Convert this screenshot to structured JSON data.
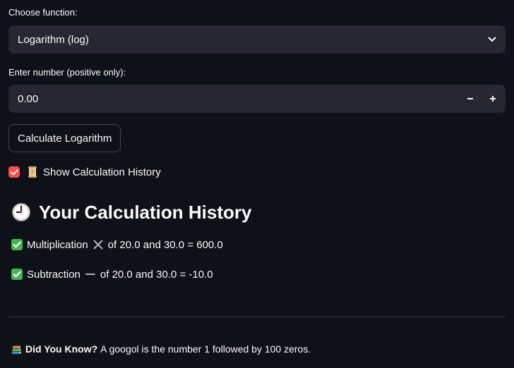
{
  "function_select": {
    "label": "Choose function:",
    "value": "Logarithm (log)"
  },
  "number_input": {
    "label": "Enter number (positive only):",
    "value": "0.00",
    "minus": "−",
    "plus": "+"
  },
  "calculate_button": {
    "label": "Calculate Logarithm"
  },
  "history_toggle": {
    "checked": true,
    "label": "Show Calculation History",
    "icon": "scroll-icon"
  },
  "history": {
    "title": "Your Calculation History",
    "title_icon": "clock-icon",
    "items": [
      {
        "icon": "check-mark-icon",
        "operation": "Multiplication",
        "operator_icon": "multiply-icon",
        "detail": "of 20.0 and 30.0 = 600.0"
      },
      {
        "icon": "check-mark-icon",
        "operation": "Subtraction",
        "operator_icon": "minus-icon",
        "detail": "of 20.0 and 30.0 = -10.0"
      }
    ]
  },
  "tip": {
    "icon": "books-icon",
    "heading": "Did You Know?",
    "text": "A googol is the number 1 followed by 100 zeros."
  },
  "colors": {
    "background": "#0e1117",
    "widget_background": "#262730",
    "accent": "#ff4b4b",
    "check_green": "#3fb950"
  }
}
